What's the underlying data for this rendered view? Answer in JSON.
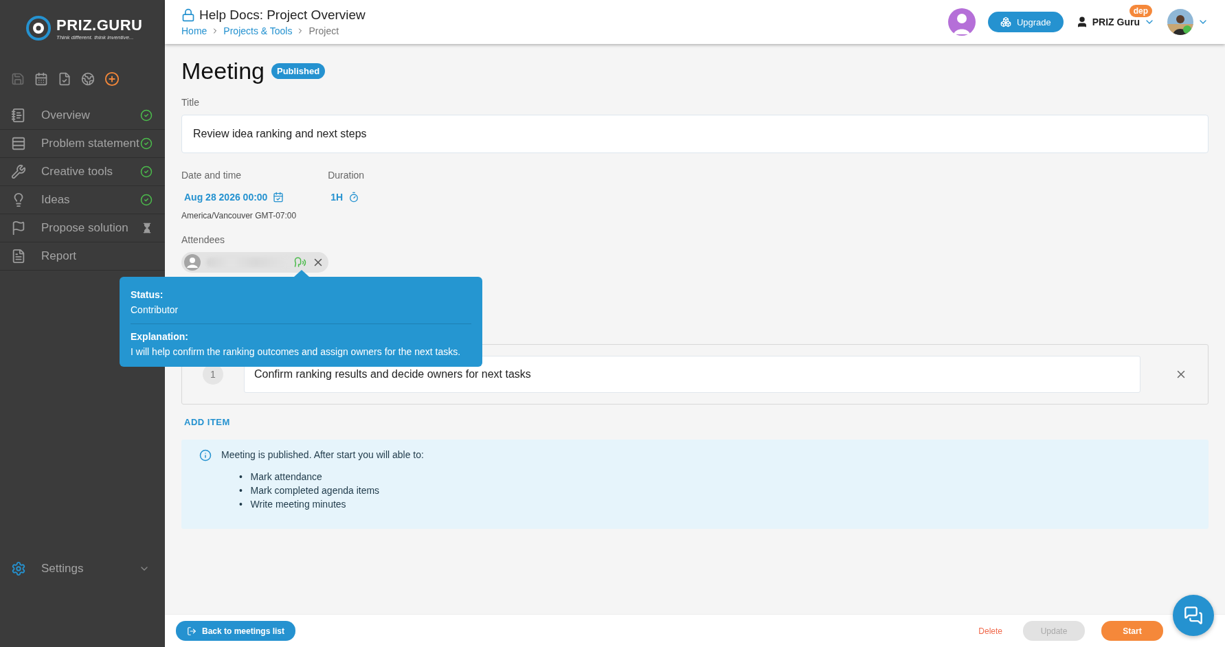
{
  "sidebar": {
    "logo": {
      "name": "PRIZ.GURU",
      "tagline": "Think different. think inventive..."
    },
    "items": [
      {
        "label": "Overview",
        "done": true
      },
      {
        "label": "Problem statement",
        "done": true
      },
      {
        "label": "Creative tools",
        "done": true
      },
      {
        "label": "Ideas",
        "done": true
      },
      {
        "label": "Propose solution",
        "done": false
      },
      {
        "label": "Report"
      }
    ],
    "settings": {
      "label": "Settings",
      "expanded": false
    }
  },
  "header": {
    "title": "Help Docs: Project Overview",
    "breadcrumbs": [
      {
        "label": "Home",
        "link": true
      },
      {
        "label": "Projects & Tools",
        "link": true
      },
      {
        "label": "Project",
        "link": false
      }
    ],
    "upgrade": "Upgrade",
    "user": "PRIZ Guru",
    "badge": "dep"
  },
  "meeting": {
    "heading": "Meeting",
    "status": "Published",
    "title_label": "Title",
    "title_value": "Review idea ranking and next steps",
    "date_label": "Date and time",
    "date_value": "Aug 28 2026 00:00",
    "timezone": "America/Vancouver GMT-07:00",
    "duration_label": "Duration",
    "duration_value": "1H",
    "attendees_label": "Attendees",
    "tooltip": {
      "status_label": "Status:",
      "status": "Contributor",
      "explanation_label": "Explanation:",
      "explanation": "I will help confirm the ranking outcomes and assign owners for the next tasks."
    },
    "agenda": [
      {
        "number": "1",
        "text": "Confirm ranking results and decide owners for next tasks"
      }
    ],
    "add_item": "ADD ITEM",
    "info": {
      "marker": "•",
      "text": "Meeting is published. After start you will able to:",
      "bullets": [
        "Mark attendance",
        "Mark completed agenda items",
        "Write meeting minutes"
      ]
    }
  },
  "footer": {
    "back": "Back to meetings list",
    "delete": "Delete",
    "update": {
      "label": "Update",
      "disabled": true
    },
    "start": "Start"
  }
}
